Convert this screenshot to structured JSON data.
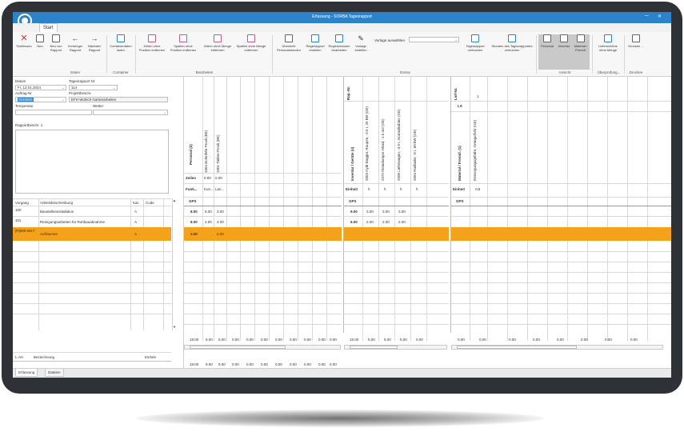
{
  "window": {
    "title": "Erfassung - SORBA Tagesrapport",
    "tab_start": "Start"
  },
  "ribbon": {
    "buttons": {
      "schliessen": "Schliessen",
      "neu": "Neu",
      "neu_von_rapport": "Neu von Rapport",
      "vorheriger": "Vorheriger Rapport",
      "naechster": "Nächster Rapport",
      "containerdaten": "Containerdaten laden",
      "zeilen_ohne_position": "Zeilen ohne Position entfernen",
      "spalten_ohne_position": "Spalten ohne Position entfernen",
      "zeilen_ohne_menge": "Zeilen ohne Menge entfernen",
      "spalten_ohne_menge": "Spalten ohne Menge entfernen",
      "uebersicht": "Übersicht Personalstunden",
      "regierapport": "Regierapport erstellen",
      "regieadressen": "Regieadressen bearbeiten",
      "vorlage_erstellen": "Vorlage erstellen",
      "vorlage_auswaehlen": "Vorlage auswählen",
      "tagesrapport_verbuchen": "Tagesrapport verbuchen",
      "stunden_verbuchen": "Stunden des Tagesrapportes verbuchen",
      "personal": "Personal",
      "inventar": "Inventar",
      "material": "Material / Fremdl.",
      "lieferscheine": "Lieferscheine ohne Menge",
      "drucken": "Drucken ..."
    },
    "groups": {
      "daten": "Daten",
      "container": "Container",
      "bearbeiten": "Bearbeiten",
      "extras": "Extras",
      "ansicht": "Ansicht",
      "ueberpruefung": "Überprüfung...",
      "drucken": "Drucken"
    }
  },
  "form": {
    "datum_label": "Datum",
    "datum_value": "Fr, 12.01.2024",
    "tagesrapport_label": "Tagesrapport Nr",
    "tagesrapport_value": "114",
    "auftrag_label": "Auftrag-Nr",
    "auftrag_value": "0040600",
    "projekt_label": "Projektbeschr.",
    "projekt_value": "EFH Wolrich Gartenarbeiten",
    "temperatur_label": "Temperatur",
    "wetter_label": "Wetter",
    "rapport_label": "Rapportbeschr. 1"
  },
  "vorgang_table": {
    "headers": [
      "Vorgang",
      "Arbeitsbeschreibung",
      "Kat.",
      "Code"
    ],
    "rows": [
      {
        "vorgang": "100",
        "beschreibung": "Baustelleninstallation",
        "kat": "A",
        "code": ""
      },
      {
        "vorgang": "101",
        "beschreibung": "Reinigungsarbeiten für Rohbauabnahme",
        "kat": "A",
        "code": ""
      },
      {
        "vorgang": "[R]999 6617",
        "beschreibung": "Aufräumen",
        "kat": "A",
        "code": ""
      }
    ]
  },
  "lart_table": {
    "headers": [
      "L-Art",
      "Bezeichnung",
      "Einheit"
    ]
  },
  "personal": {
    "section_title": "Personal (2)",
    "zeilen_label": "Zeilen",
    "funk_label": "Funk...",
    "gps_label": "GPS",
    "columns": [
      {
        "name": "1004 Bolenfehr Prosli (BE)",
        "zeilen": "0.00",
        "funk": "Kun...",
        "values": [
          "5.00",
          "4.00",
          ""
        ]
      },
      {
        "name": "1001 Tinkler-Prosli (BE)",
        "zeilen": "0.00",
        "funk": "Lan...",
        "values": [
          "3.00",
          "4.00",
          "2.00"
        ]
      }
    ],
    "row_totals": [
      "8.00",
      "8.00",
      "2.00"
    ],
    "footer": [
      "18.00",
      "9.00",
      "9.00",
      "0.00",
      "0.00",
      "0.00",
      "0.00",
      "0.00",
      "0.00",
      "0.00",
      "0.00"
    ],
    "footer2": [
      "18.00",
      "9.00",
      "9.00",
      "0.00",
      "0.00",
      "0.00",
      "0.00",
      "0.00",
      "0.00",
      "0.00",
      "0.00"
    ]
  },
  "inventar": {
    "section_title": "Inventar / Geräte (4)",
    "rap_label": "Rap.-Nr.",
    "einheit_label": "Einheit",
    "gps_label": "GPS",
    "columns": [
      {
        "name": "2003 Hydr.Bagger, Raupen, -3.5 t, 25 kW (GE)",
        "einheit": "h",
        "values": [
          "3.00",
          "2.00"
        ]
      },
      {
        "name": "2372 Kleindumper Allrad, -1.5 m3 (GE)",
        "einheit": "h",
        "values": [
          "3.00",
          "2.00"
        ]
      },
      {
        "name": "2506 Lieferwagen, -3.5 t, Normalkabine (GE)",
        "einheit": "h",
        "values": [
          "3.00",
          "2.00"
        ]
      },
      {
        "name": "2604 Radlader, -8 t, 60 kW (GE)",
        "einheit": "h",
        "values": [
          "",
          ""
        ]
      }
    ],
    "row_totals": [
      "9.00",
      "6.00"
    ],
    "footer": [
      "15.00",
      "5.00",
      "5.00",
      "5.00",
      "0.00"
    ]
  },
  "material": {
    "section_title": "Material / Fremdl. (1)",
    "lief_label": "Lief-Nr.",
    "ls_label": "LS",
    "einheit_label": "Einheit",
    "gps_label": "GPS",
    "lief_value": "1",
    "columns": [
      {
        "name": "Entsorgungsgebühr, Grüngutfuhr (GE)",
        "einheit": "m3"
      }
    ],
    "footer": [
      "0.00",
      "0.00",
      "0.00",
      "0.00",
      "0.00",
      "0.00",
      "0.00",
      "0.00"
    ]
  },
  "bottom_tabs": [
    "Erfassung",
    "Dateien"
  ],
  "colors": {
    "titlebar": "#2d83c9",
    "selection": "#f4a21c",
    "frame": "#2e3237"
  }
}
